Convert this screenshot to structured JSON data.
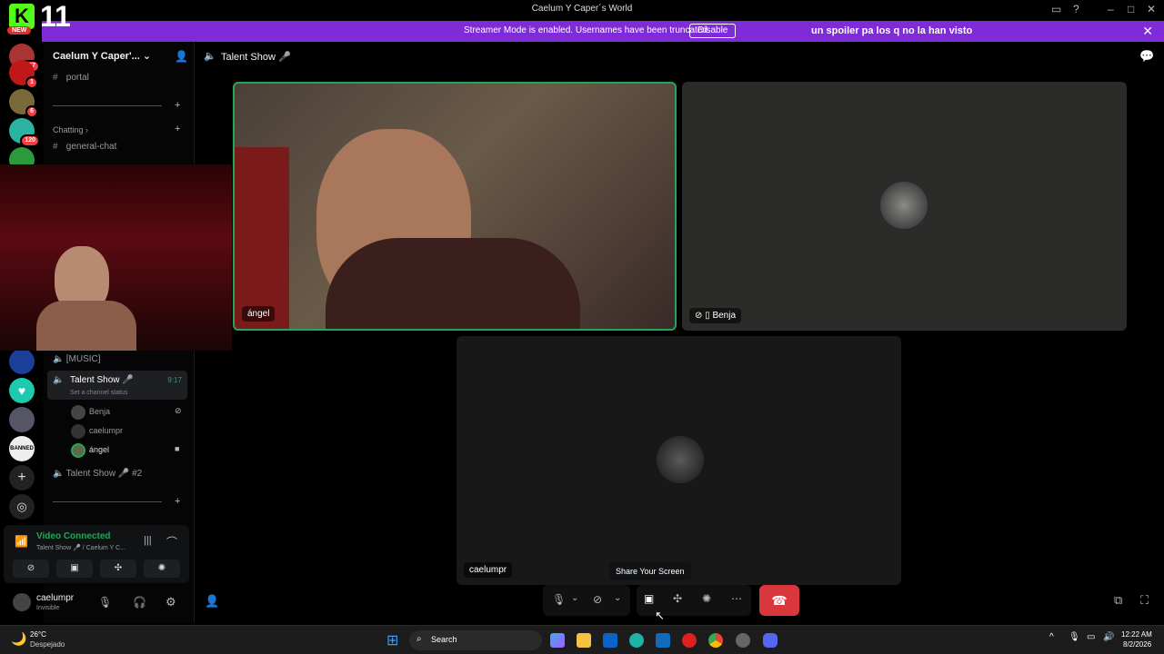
{
  "window": {
    "title": "Caelum Y Caper´s World"
  },
  "overlay": {
    "counter": "11",
    "new_label": "NEW"
  },
  "banner": {
    "message": "Streamer Mode is enabled. Usernames have been truncated.",
    "disable_label": "Disable",
    "extra_text": "un spoiler pa los q no la han visto"
  },
  "servers": [
    {
      "badge": "267"
    },
    {
      "badge": "1"
    },
    {
      "badge": "6"
    },
    {
      "badge": "120"
    },
    {
      "badge": ""
    }
  ],
  "sidebar": {
    "server_name": "Caelum Y Caper'...",
    "channels": {
      "portal": "portal",
      "category_chatting": "Chatting",
      "general_chat": "general-chat",
      "music": "[MUSIC]",
      "talent_show": "Talent Show 🎤",
      "talent_show_time": "9:17",
      "channel_status_placeholder": "Set a channel status",
      "talent_show_2": "Talent Show 🎤 #2"
    },
    "voice_members": [
      "Benja",
      "caelumpr",
      "ángel"
    ]
  },
  "voice_panel": {
    "status": "Video Connected",
    "channel": "Talent Show 🎤 / Caelum Y C...",
    "colors": {
      "connected": "#23a55a"
    }
  },
  "user_panel": {
    "username": "caelumpr",
    "status": "Invisible"
  },
  "header": {
    "channel_name": "Talent Show 🎤"
  },
  "tiles": {
    "angel": "ángel",
    "benja": "Benja",
    "caelumpr": "caelumpr"
  },
  "controls": {
    "tooltip": "Share Your Screen"
  },
  "taskbar": {
    "temp": "26°C",
    "weather": "Despejado",
    "search": "Search",
    "time": "12:22 AM",
    "date": "8/2/2026"
  },
  "colors": {
    "accent": "#7f2bd8",
    "danger": "#da373c",
    "speaking": "#23a55a"
  }
}
